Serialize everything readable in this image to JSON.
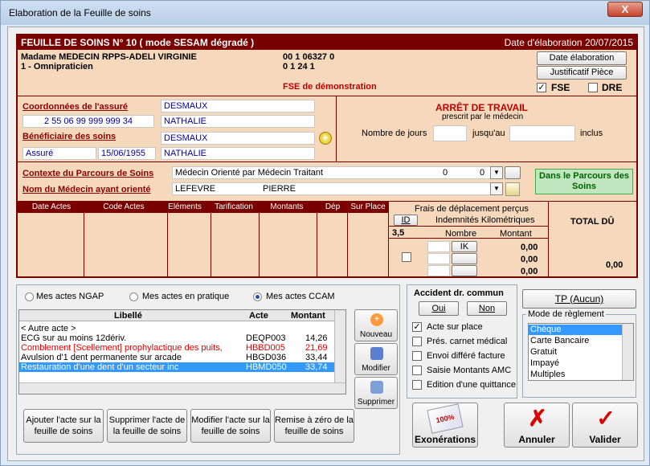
{
  "window": {
    "title": "Elaboration de la Feuille de soins",
    "close_label": "X"
  },
  "sheet": {
    "header_left": "FEUILLE DE SOINS  N° 10 ( mode SESAM dégradé )",
    "header_right": "Date d'élaboration 20/07/2015",
    "doctor_name": "Madame MEDECIN RPPS-ADELI VIRGINIE",
    "doctor_specialty": "1 - Omnipraticien",
    "code1": "00 1 06327 0",
    "code2": "0 1 24 1",
    "demo": "FSE de démonstration",
    "btn_date": "Date élaboration",
    "btn_justif": "Justificatif Pièce",
    "fse_label": "FSE",
    "fse_checked": "✓",
    "dre_label": "DRE"
  },
  "insured": {
    "coord_label": "Coordonnées de l'assuré",
    "name": "DESMAUX",
    "ssn": "2 55 06 99 999 999 34",
    "firstname": "NATHALIE",
    "benef_label": "Bénéficiaire des soins",
    "benef_name": "DESMAUX",
    "status": "Assuré",
    "birth": "15/06/1955",
    "benef_firstname": "NATHALIE"
  },
  "arret": {
    "title": "ARRÊT DE TRAVAIL",
    "subtitle": "prescrit par le médecin",
    "days_label": "Nombre de jours",
    "until_label": "jusqu'au",
    "incl_label": "inclus"
  },
  "parcours": {
    "context_label": "Contexte du Parcours de Soins",
    "context_value": "Médecin Orienté par Médecin Traitant",
    "ctx_n1": "0",
    "ctx_n2": "0",
    "doctor_label": "Nom du Médecin ayant orienté",
    "doctor_last": "LEFEVRE",
    "doctor_first": "PIERRE",
    "badge": "Dans le Parcours des Soins"
  },
  "table": {
    "headers": [
      "Date Actes",
      "Code Actes",
      "Eléments",
      "Tarification",
      "Montants",
      "Dép",
      "Sur Place"
    ],
    "frais_title": "Frais de déplacement perçus",
    "id_label": "ID",
    "ik_title": "Indemnités Kilométriques",
    "id_value": "3,5",
    "nombre_label": "Nombre",
    "montant_label": "Montant",
    "ik_btn": "IK",
    "amounts": [
      "0,00",
      "0,00",
      "0,00"
    ],
    "total_label": "TOTAL DÛ",
    "total_value": "0,00"
  },
  "acts": {
    "radio_ngap": "Mes actes NGAP",
    "radio_pratique": "Mes actes en pratique",
    "radio_ccam": "Mes actes CCAM",
    "col_libelle": "Libellé",
    "col_acte": "Acte",
    "col_montant": "Montant",
    "rows": [
      {
        "libelle": "< Autre acte >",
        "acte": "",
        "montant": ""
      },
      {
        "libelle": "ECG sur au moins 12dériv.",
        "acte": "DEQP003",
        "montant": "14,26"
      },
      {
        "libelle": "Comblement [Scellement] prophylactique des puits,",
        "acte": "HBBD005",
        "montant": "21,69"
      },
      {
        "libelle": "Avulsion d'1 dent permanente sur arcade",
        "acte": "HBGD036",
        "montant": "33,44"
      },
      {
        "libelle": "Restauration d'une dent d'un secteur inc",
        "acte": "HBMD050",
        "montant": "33,74"
      }
    ],
    "btn_nouveau": "Nouveau",
    "btn_modifier": "Modifier",
    "btn_supprimer": "Supprimer",
    "btn_add": "Ajouter l'acte sur la feuille de soins",
    "btn_del": "Supprimer l'acte de la feuille de soins",
    "btn_mod": "Modifier l'acte sur la feuille de soins",
    "btn_reset": "Remise à zéro de la feuille de soins"
  },
  "accident": {
    "title": "Accident dr. commun",
    "btn_oui": "Oui",
    "btn_non": "Non",
    "options": [
      "Acte sur place",
      "Prés. carnet médical",
      "Envoi différé facture",
      "Saisie Montants AMC",
      "Edition d'une quittance"
    ],
    "check": "✓"
  },
  "payment": {
    "tp_btn": "TP (Aucun)",
    "mode_title": "Mode de règlement",
    "modes": [
      "Chèque",
      "Carte Bancaire",
      "Gratuit",
      "Impayé",
      "Multiples"
    ]
  },
  "actions": {
    "exonerations": "Exonérations",
    "annuler": "Annuler",
    "valider": "Valider",
    "stamp": "100%"
  },
  "colors": {
    "accent": "#7a0000",
    "sheet_bg": "#f6d8bd",
    "selection": "#3399ff"
  }
}
